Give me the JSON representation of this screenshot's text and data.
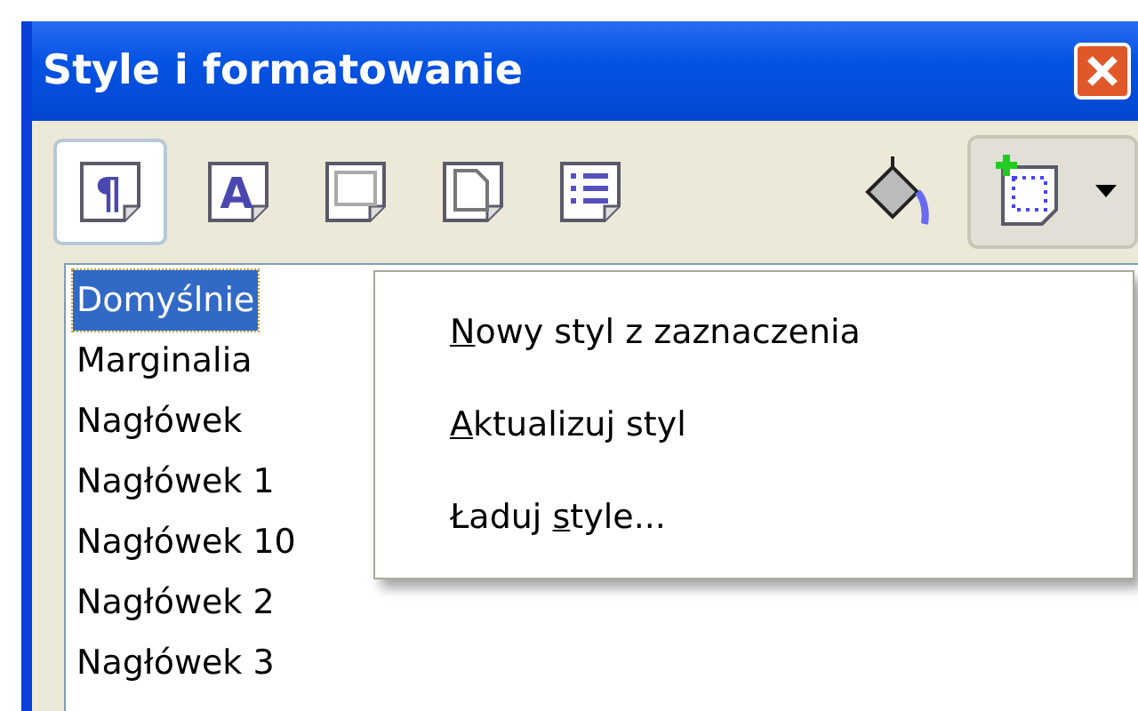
{
  "window": {
    "title": "Style i formatowanie"
  },
  "toolbar": {
    "style_buttons": [
      {
        "kind": "paragraph",
        "glyph": "¶",
        "selected": true
      },
      {
        "kind": "character",
        "glyph": "A",
        "selected": false
      },
      {
        "kind": "frame",
        "selected": false
      },
      {
        "kind": "page",
        "selected": false
      },
      {
        "kind": "list",
        "selected": false
      }
    ]
  },
  "styles_list": [
    {
      "label": "Domyślnie",
      "selected": true
    },
    {
      "label": "Marginalia",
      "selected": false
    },
    {
      "label": "Nagłówek",
      "selected": false
    },
    {
      "label": "Nagłówek 1",
      "selected": false
    },
    {
      "label": "Nagłówek 10",
      "selected": false
    },
    {
      "label": "Nagłówek 2",
      "selected": false
    },
    {
      "label": "Nagłówek 3",
      "selected": false
    }
  ],
  "context_menu": [
    {
      "accel": "N",
      "rest": "owy styl z zaznaczenia"
    },
    {
      "accel": "A",
      "rest": "ktualizuj styl"
    },
    {
      "lead": "Ładuj ",
      "accel": "s",
      "rest": "tyle..."
    }
  ]
}
